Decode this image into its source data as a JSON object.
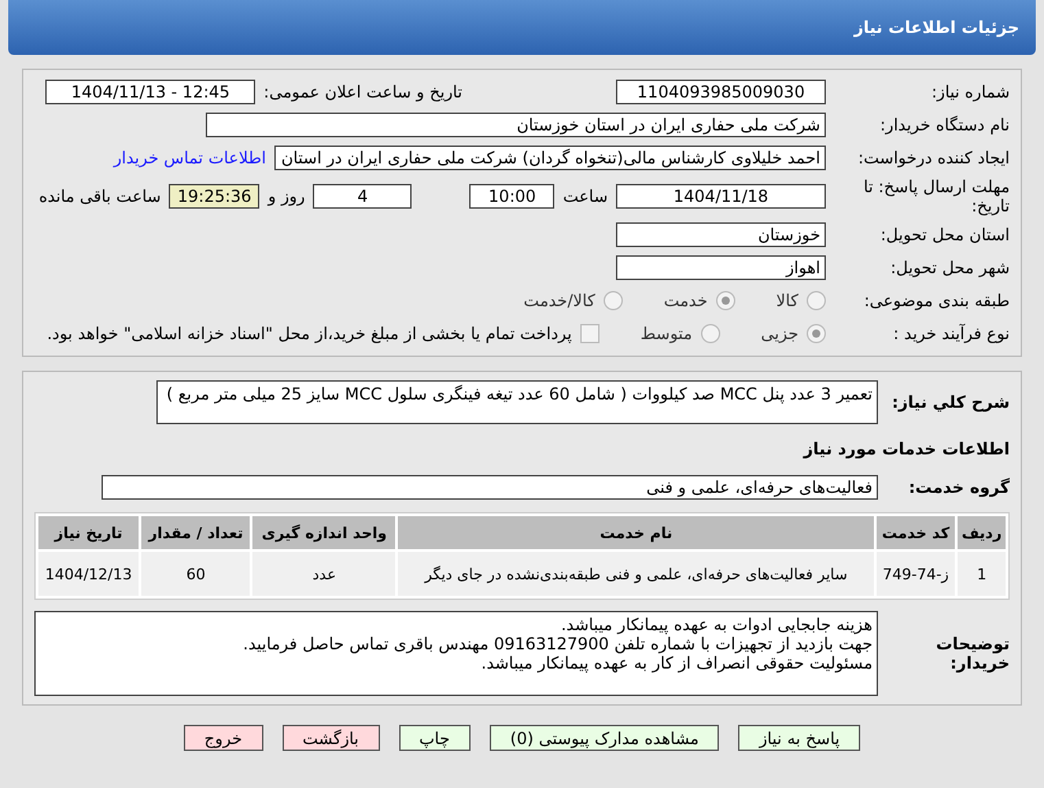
{
  "header": {
    "title": "جزئیات اطلاعات نیاز"
  },
  "details": {
    "need_number": {
      "label": "شماره نیاز:",
      "value": "1104093985009030"
    },
    "announce": {
      "label": "تاریخ و ساعت اعلان عمومی:",
      "value": "1404/11/13 - 12:45"
    },
    "buyer": {
      "label": "نام دستگاه خریدار:",
      "value": "شرکت ملی حفاری ایران در استان خوزستان"
    },
    "creator": {
      "label": "ایجاد کننده درخواست:",
      "value": "احمد خلیلاوی کارشناس مالی(تنخواه گردان) شرکت ملی حفاری ایران در استان",
      "link": "اطلاعات تماس خریدار"
    },
    "deadline": {
      "label": "مهلت ارسال پاسخ: تا تاریخ:",
      "date": "1404/11/18",
      "time_label": "ساعت",
      "time": "10:00",
      "days": "4",
      "days_label": "روز و",
      "remaining": "19:25:36",
      "remaining_label": "ساعت باقی مانده"
    },
    "province": {
      "label": "استان محل تحویل:",
      "value": "خوزستان"
    },
    "city": {
      "label": "شهر محل تحویل:",
      "value": "اهواز"
    },
    "category": {
      "label": "طبقه بندی موضوعی:",
      "options": [
        {
          "label": "کالا",
          "selected": false
        },
        {
          "label": "خدمت",
          "selected": true
        },
        {
          "label": "کالا/خدمت",
          "selected": false
        }
      ]
    },
    "process": {
      "label": "نوع فرآیند خرید :",
      "options": [
        {
          "label": "جزیی",
          "selected": true
        },
        {
          "label": "متوسط",
          "selected": false
        }
      ],
      "payment": {
        "checked": false,
        "label": "پرداخت تمام یا بخشی از مبلغ خرید،از محل \"اسناد خزانه اسلامی\" خواهد بود."
      }
    }
  },
  "need": {
    "label": "شرح کلي نياز:",
    "value": "تعمیر 3 عدد پنل MCC صد کیلووات ( شامل 60 عدد تیغه فینگری سلول MCC سایز 25 میلی متر مربع )"
  },
  "services_title": "اطلاعات خدمات مورد نیاز",
  "service_group": {
    "label": "گروه خدمت:",
    "value": "فعالیت‌های حرفه‌ای، علمی و فنی"
  },
  "table": {
    "columns": [
      "ردیف",
      "کد خدمت",
      "نام خدمت",
      "واحد اندازه گیری",
      "تعداد / مقدار",
      "تاریخ نیاز"
    ],
    "rows": [
      [
        "1",
        "ز-74-749",
        "سایر فعالیت‌های حرفه‌ای، علمی و فنی طبقه‌بندی‌نشده در جای دیگر",
        "عدد",
        "60",
        "1404/12/13"
      ]
    ]
  },
  "notes": {
    "label": "توضیحات خریدار:",
    "lines": [
      "هزینه جابجایی ادوات به عهده پیمانکار میباشد.",
      "جهت بازدید از تجهیزات با شماره تلفن  09163127900 مهندس باقری تماس حاصل فرمایید.",
      "مسئولیت حقوقی انصراف از کار به عهده پیمانکار میباشد."
    ]
  },
  "buttons": [
    {
      "label": "پاسخ به نیاز",
      "kind": "primary"
    },
    {
      "label": "مشاهده مدارک پیوستی (0)",
      "kind": "primary"
    },
    {
      "label": "چاپ",
      "kind": "primary"
    },
    {
      "label": "بازگشت",
      "kind": "danger"
    },
    {
      "label": "خروج",
      "kind": "danger"
    }
  ]
}
